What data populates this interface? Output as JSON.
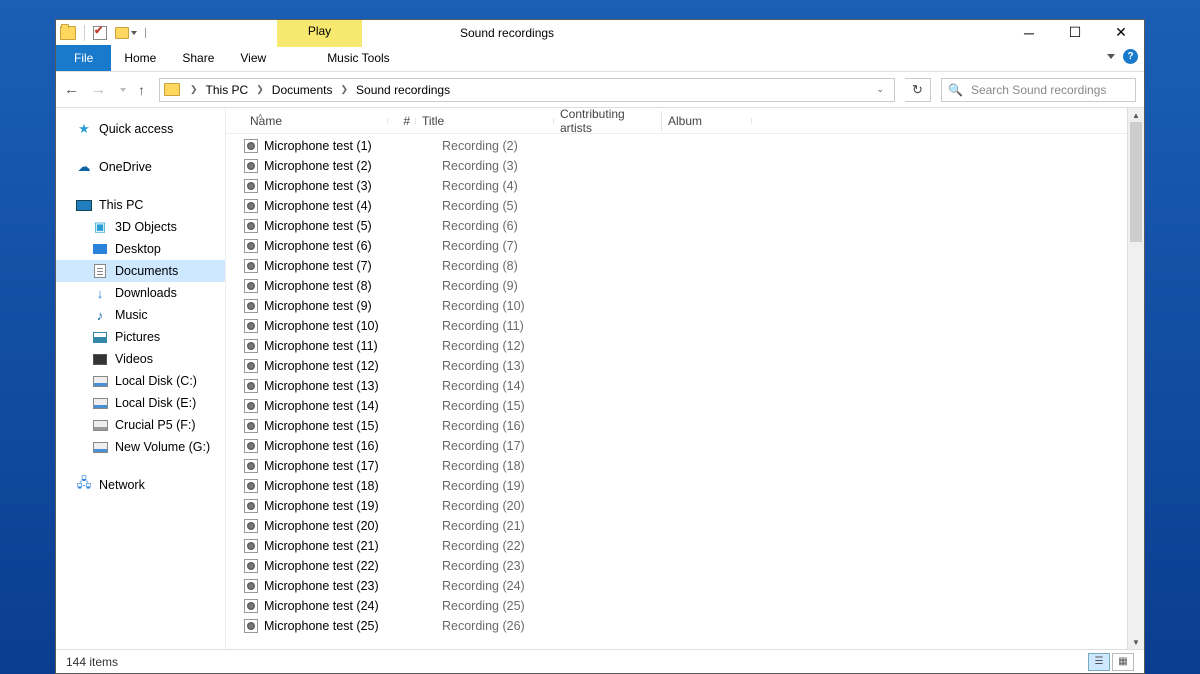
{
  "window_title": "Sound recordings",
  "ribbon": {
    "context_label": "Play",
    "tabs": {
      "file": "File",
      "home": "Home",
      "share": "Share",
      "view": "View",
      "music": "Music Tools"
    }
  },
  "breadcrumbs": [
    "This PC",
    "Documents",
    "Sound recordings"
  ],
  "search": {
    "placeholder": "Search Sound recordings"
  },
  "sidebar": {
    "quick_access": "Quick access",
    "onedrive": "OneDrive",
    "this_pc": "This PC",
    "children": [
      {
        "label": "3D Objects"
      },
      {
        "label": "Desktop"
      },
      {
        "label": "Documents"
      },
      {
        "label": "Downloads"
      },
      {
        "label": "Music"
      },
      {
        "label": "Pictures"
      },
      {
        "label": "Videos"
      },
      {
        "label": "Local Disk (C:)"
      },
      {
        "label": "Local Disk (E:)"
      },
      {
        "label": "Crucial P5 (F:)"
      },
      {
        "label": "New Volume (G:)"
      }
    ],
    "network": "Network"
  },
  "columns": {
    "name": "Name",
    "num": "#",
    "title": "Title",
    "contrib": "Contributing artists",
    "album": "Album"
  },
  "files": [
    {
      "name": "Microphone test (1)",
      "title": "Recording (2)"
    },
    {
      "name": "Microphone test (2)",
      "title": "Recording (3)"
    },
    {
      "name": "Microphone test (3)",
      "title": "Recording (4)"
    },
    {
      "name": "Microphone test (4)",
      "title": "Recording (5)"
    },
    {
      "name": "Microphone test (5)",
      "title": "Recording (6)"
    },
    {
      "name": "Microphone test (6)",
      "title": "Recording (7)"
    },
    {
      "name": "Microphone test (7)",
      "title": "Recording (8)"
    },
    {
      "name": "Microphone test (8)",
      "title": "Recording (9)"
    },
    {
      "name": "Microphone test (9)",
      "title": "Recording (10)"
    },
    {
      "name": "Microphone test (10)",
      "title": "Recording (11)"
    },
    {
      "name": "Microphone test (11)",
      "title": "Recording (12)"
    },
    {
      "name": "Microphone test (12)",
      "title": "Recording (13)"
    },
    {
      "name": "Microphone test (13)",
      "title": "Recording (14)"
    },
    {
      "name": "Microphone test (14)",
      "title": "Recording (15)"
    },
    {
      "name": "Microphone test (15)",
      "title": "Recording (16)"
    },
    {
      "name": "Microphone test (16)",
      "title": "Recording (17)"
    },
    {
      "name": "Microphone test (17)",
      "title": "Recording (18)"
    },
    {
      "name": "Microphone test (18)",
      "title": "Recording (19)"
    },
    {
      "name": "Microphone test (19)",
      "title": "Recording (20)"
    },
    {
      "name": "Microphone test (20)",
      "title": "Recording (21)"
    },
    {
      "name": "Microphone test (21)",
      "title": "Recording (22)"
    },
    {
      "name": "Microphone test (22)",
      "title": "Recording (23)"
    },
    {
      "name": "Microphone test (23)",
      "title": "Recording (24)"
    },
    {
      "name": "Microphone test (24)",
      "title": "Recording (25)"
    },
    {
      "name": "Microphone test (25)",
      "title": "Recording (26)"
    }
  ],
  "status": {
    "text": "144 items"
  }
}
